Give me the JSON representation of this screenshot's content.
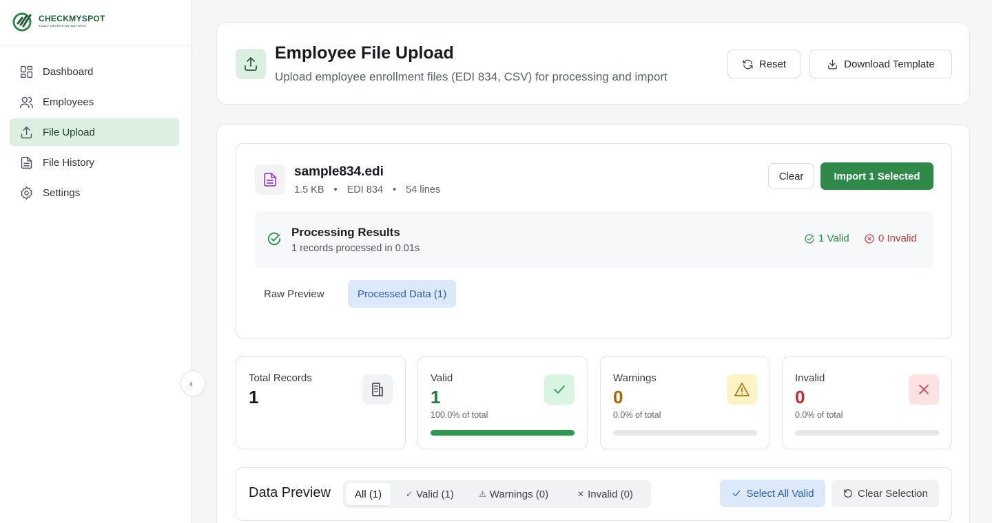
{
  "brand": {
    "name": "CHECKMYSPOT",
    "tagline": "EARLY DETECTION MATTERS",
    "accent": "#2f8a4a"
  },
  "sidebar": {
    "items": [
      {
        "label": "Dashboard",
        "icon": "dashboard-icon",
        "active": false
      },
      {
        "label": "Employees",
        "icon": "users-icon",
        "active": false
      },
      {
        "label": "File Upload",
        "icon": "upload-icon",
        "active": true
      },
      {
        "label": "File History",
        "icon": "file-icon",
        "active": false
      },
      {
        "label": "Settings",
        "icon": "gear-icon",
        "active": false
      }
    ],
    "collapse_glyph": "‹"
  },
  "header": {
    "title": "Employee File Upload",
    "subtitle": "Upload employee enrollment files (EDI 834, CSV) for processing and import",
    "reset_label": "Reset",
    "download_label": "Download Template"
  },
  "file": {
    "name": "sample834.edi",
    "size": "1.5 KB",
    "type": "EDI 834",
    "lines": "54 lines",
    "separator": "•",
    "clear_label": "Clear",
    "import_label": "Import 1 Selected"
  },
  "results": {
    "title": "Processing Results",
    "summary": "1 records processed in 0.01s",
    "valid_label": "1 Valid",
    "invalid_label": "0 Invalid"
  },
  "tabs": [
    {
      "label": "Raw Preview",
      "active": false
    },
    {
      "label": "Processed Data (1)",
      "active": true
    }
  ],
  "stats": [
    {
      "label": "Total Records",
      "value": "1",
      "pct": "",
      "color": "#17191c",
      "fill": null
    },
    {
      "label": "Valid",
      "value": "1",
      "pct": "100.0% of total",
      "color": "#1f7a3b",
      "fill": 1.0,
      "bar_color": "#2a9a4c"
    },
    {
      "label": "Warnings",
      "value": "0",
      "pct": "0.0% of total",
      "color": "#a8660c",
      "fill": 0.0,
      "bar_color": "#e0a417"
    },
    {
      "label": "Invalid",
      "value": "0",
      "pct": "0.0% of total",
      "color": "#c22b2b",
      "fill": 0.0,
      "bar_color": "#d64545"
    }
  ],
  "preview": {
    "title": "Data Preview",
    "filters": [
      {
        "label": "All (1)",
        "mark": "",
        "active": true
      },
      {
        "label": "Valid (1)",
        "mark": "✓",
        "active": false
      },
      {
        "label": "Warnings (0)",
        "mark": "⚠",
        "active": false
      },
      {
        "label": "Invalid (0)",
        "mark": "✕",
        "active": false
      }
    ],
    "select_all_label": "Select All Valid",
    "clear_selection_label": "Clear Selection"
  }
}
